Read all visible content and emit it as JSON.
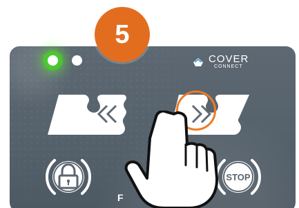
{
  "step": {
    "number": "5"
  },
  "brand": {
    "title": "COVER",
    "subtitle": "CONNECT"
  },
  "controls": {
    "stop_label": "STOP"
  },
  "overlay": {
    "partial_label": "F"
  },
  "colors": {
    "panel": "#55616b",
    "accent": "#e36d1f",
    "white": "#ffffff",
    "green": "#45db16"
  },
  "icons": {
    "left_arrows": "double-chevron-left-icon",
    "right_arrows": "double-chevron-right-icon",
    "lock": "lock-icon",
    "stop": "stop-icon",
    "hand": "hand-pointer-icon",
    "logo": "cover-connect-logo-icon"
  }
}
